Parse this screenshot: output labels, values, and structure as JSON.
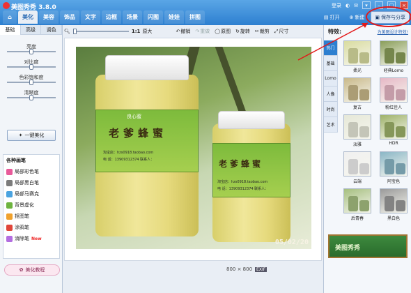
{
  "app": {
    "title": "美图秀秀 3.8.0",
    "login_label": "登录"
  },
  "tabs": [
    {
      "label": "美化",
      "active": true
    },
    {
      "label": "美容"
    },
    {
      "label": "饰品"
    },
    {
      "label": "文字"
    },
    {
      "label": "边框"
    },
    {
      "label": "场景"
    },
    {
      "label": "闪图"
    },
    {
      "label": "娃娃"
    },
    {
      "label": "拼图"
    }
  ],
  "actions": {
    "open": "打开",
    "new": "新建",
    "save_share": "保存与分享"
  },
  "left_panel": {
    "subtabs": [
      "基础",
      "高级",
      "调色"
    ],
    "sliders": [
      {
        "label": "亮度",
        "value": 0.5
      },
      {
        "label": "对比度",
        "value": 0.5
      },
      {
        "label": "色彩饱和度",
        "value": 0.5
      },
      {
        "label": "清晰度",
        "value": 0.5
      }
    ],
    "one_click": "一键美化",
    "brush_title": "各种画笔",
    "brushes": [
      {
        "label": "局部彩色笔",
        "color": "#e85a9a"
      },
      {
        "label": "局部黑白笔",
        "color": "#7b7b7b"
      },
      {
        "label": "局部马赛克",
        "color": "#4aa3e0"
      },
      {
        "label": "背景虚化",
        "color": "#6db33f"
      },
      {
        "label": "抠图笔",
        "color": "#f0a12d"
      },
      {
        "label": "涂鸦笔",
        "color": "#e0453a"
      },
      {
        "label": "消除笔",
        "color": "#b36de0",
        "badge": "New"
      }
    ],
    "tutorial": "美化教程"
  },
  "toolbar": {
    "zoom_label": "1:1",
    "zoom_value": 0.0,
    "original_size": "原大",
    "undo": "撤销",
    "redo": "重做",
    "original": "原图",
    "rotate": "旋转",
    "crop": "裁剪",
    "resize": "尺寸"
  },
  "photo": {
    "brand": "良心蜜",
    "title": "老爹蜂蜜",
    "shop_line": "淘宝店：hzs0918.taobao.com",
    "phone_line": "电  话：13909312374  联系人：",
    "shop_line_small": "淘宝店：hzs0918.taobao.com",
    "phone_line_small": "电  话：13909312374  联系人：",
    "date_stamp": "05/02/20"
  },
  "status": {
    "dimensions": "800 × 800",
    "exif": "EXIF"
  },
  "right_panel": {
    "title": "特效:",
    "link": "为美图设计特效!",
    "categories": [
      "热门",
      "基础",
      "Lomo",
      "人像",
      "时尚",
      "艺术"
    ],
    "effects": [
      {
        "label": "柔光",
        "tint": "#d9dca0"
      },
      {
        "label": "经典Lomo",
        "tint": "#8a9e5a"
      },
      {
        "label": "复古",
        "tint": "#c9b98a"
      },
      {
        "label": "粉红佳人",
        "tint": "#e6b8c6"
      },
      {
        "label": "淡雅",
        "tint": "#e6e8d8"
      },
      {
        "label": "HDR",
        "tint": "#9eb26a"
      },
      {
        "label": "云端",
        "tint": "#f0f0f0"
      },
      {
        "label": "阿宝色",
        "tint": "#8ab6c6"
      },
      {
        "label": "后青春",
        "tint": "#a6bf80"
      },
      {
        "label": "黑白色",
        "tint": "#9a9a9a"
      }
    ],
    "ad_text": "美图秀秀"
  }
}
